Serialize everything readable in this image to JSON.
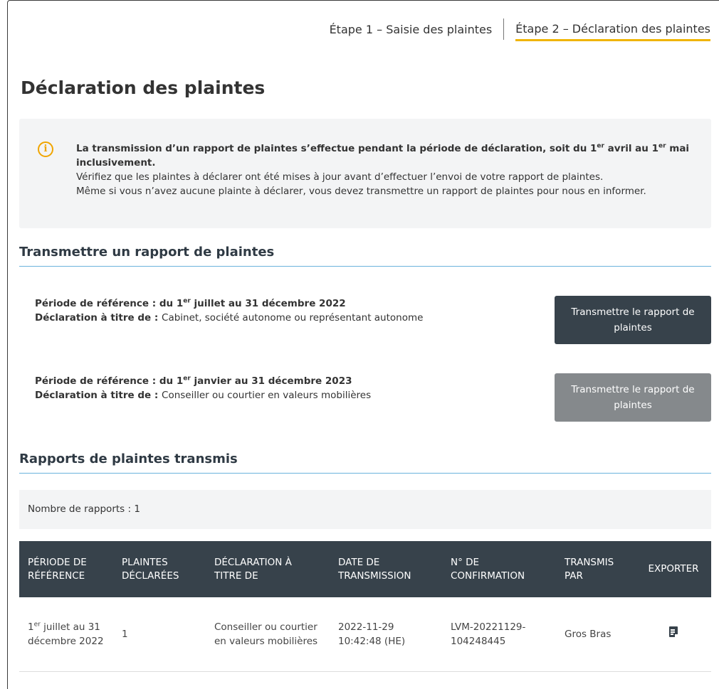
{
  "steps": {
    "step1": "Étape 1 – Saisie des plaintes",
    "step2": "Étape 2 – Déclaration des plaintes"
  },
  "page": {
    "title": "Déclaration des plaintes"
  },
  "info": {
    "bold_line_a": "La transmission d’un rapport de plaintes s’effectue pendant la période de déclaration, soit du 1",
    "sup1": "er",
    "bold_line_b": " avril au 1",
    "sup2": "er",
    "bold_line_c": " mai inclusivement.",
    "line2": "Vérifiez que les plaintes à déclarer ont été mises à jour avant d’effectuer l’envoi de votre rapport de plaintes.",
    "line3": "Même si vous n’avez aucune plainte à déclarer, vous devez transmettre un rapport de plaintes pour nous en informer."
  },
  "transmit": {
    "section_title": "Transmettre un rapport de plaintes",
    "periods": [
      {
        "period_label_a": "Période de référence : du 1",
        "period_sup": "er",
        "period_label_b": " juillet au 31 décembre 2022",
        "decl_label": "Déclaration à titre de : ",
        "decl_value": "Cabinet, société autonome ou représentant autonome",
        "button": "Transmettre le rapport de plaintes"
      },
      {
        "period_label_a": "Période de référence : du 1",
        "period_sup": "er",
        "period_label_b": " janvier au 31 décembre 2023",
        "decl_label": "Déclaration à titre de : ",
        "decl_value": "Conseiller ou courtier en valeurs mobilières",
        "button": "Transmettre le rapport de plaintes"
      }
    ]
  },
  "reports": {
    "section_title": "Rapports de plaintes transmis",
    "count_label": "Nombre de rapports : 1",
    "columns": [
      "PÉRIODE DE RÉFÉRENCE",
      "PLAINTES DÉCLARÉES",
      "DÉCLARATION À TITRE DE",
      "DATE DE TRANSMISSION",
      "N° DE CONFIRMATION",
      "TRANSMIS PAR",
      "EXPORTER"
    ],
    "rows": [
      {
        "period_a": "1",
        "period_sup": "er",
        "period_b": " juillet au 31 décembre 2022",
        "complaints": "1",
        "declaration": "Conseiller ou courtier en valeurs mobilières",
        "date": "2022-11-29 10:42:48 (HE)",
        "confirmation": "LVM-20221129-104248445",
        "sent_by": "Gros Bras",
        "export_icon": "document-export-icon"
      }
    ]
  },
  "colors": {
    "accent": "#f0b400",
    "dark": "#37424b",
    "disabled": "#85898c",
    "rule": "#6bb3dc",
    "info_icon": "#f0a500"
  }
}
